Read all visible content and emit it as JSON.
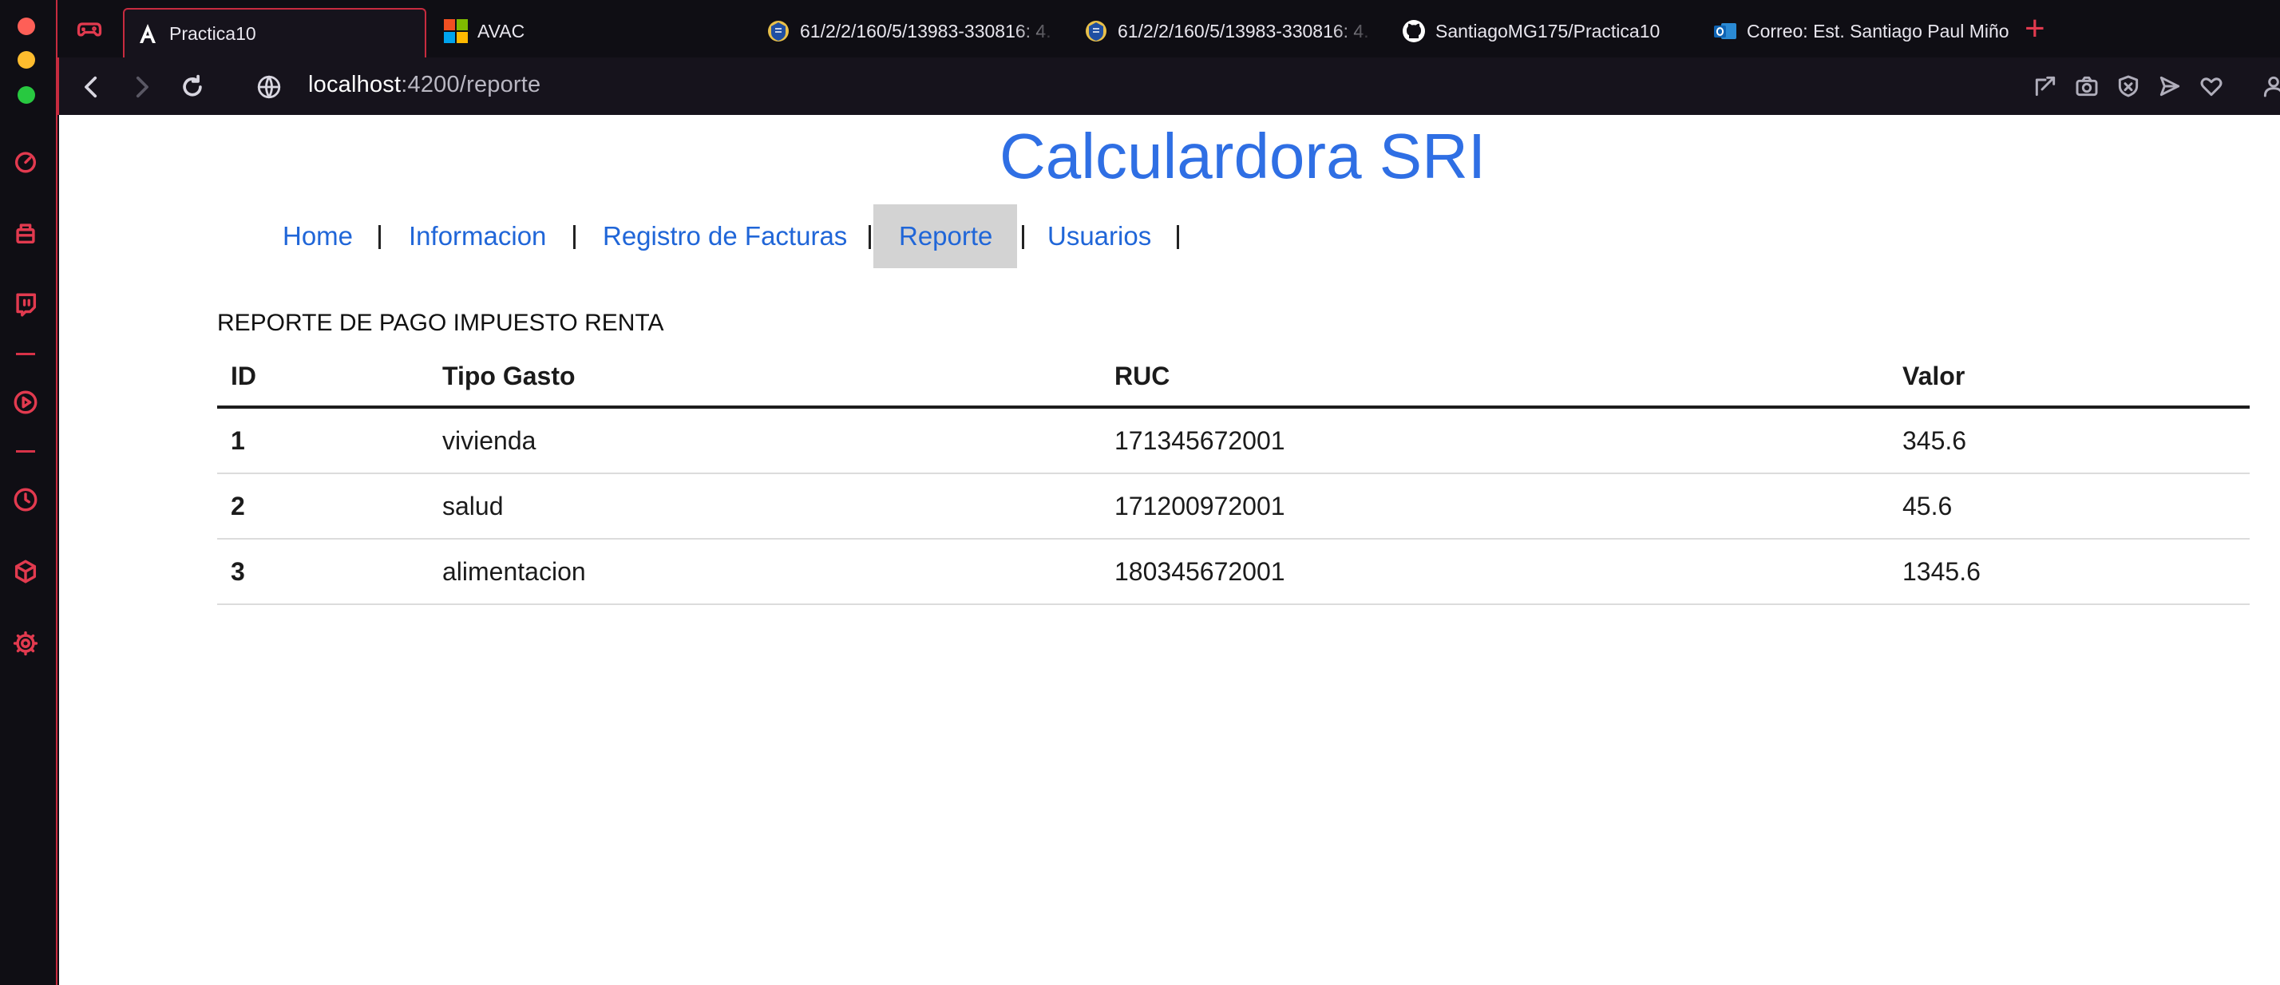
{
  "browser": {
    "tabs": [
      {
        "label": "Practica10",
        "icon": "angular-a-icon",
        "active": true
      },
      {
        "label": "AVAC",
        "icon": "microsoft-logo-icon",
        "active": false
      },
      {
        "label": "61/2/2/160/5/13983-330816: 4.",
        "icon": "university-crest-icon",
        "active": false
      },
      {
        "label": "61/2/2/160/5/13983-330816: 4.",
        "icon": "university-crest-icon",
        "active": false
      },
      {
        "label": "SantiagoMG175/Practica10",
        "icon": "github-icon",
        "active": false
      },
      {
        "label": "Correo: Est. Santiago Paul Miño",
        "icon": "outlook-icon",
        "active": false
      }
    ],
    "new_tab": "+",
    "address": {
      "host": "localhost",
      "path": ":4200/reporte"
    },
    "accent": "#c72b3f"
  },
  "page": {
    "title": "Calculardora SRI",
    "title_color": "#2f6fe4",
    "nav": [
      {
        "label": "Home",
        "active": false
      },
      {
        "label": "Informacion",
        "active": false
      },
      {
        "label": "Registro de Facturas",
        "active": false
      },
      {
        "label": "Reporte",
        "active": true
      },
      {
        "label": "Usuarios",
        "active": false
      }
    ],
    "nav_separator": "|",
    "report_heading": "REPORTE DE PAGO IMPUESTO RENTA",
    "table": {
      "columns": [
        "ID",
        "Tipo Gasto",
        "RUC",
        "Valor"
      ],
      "rows": [
        {
          "id": "1",
          "tipo": "vivienda",
          "ruc": "171345672001",
          "valor": "345.6"
        },
        {
          "id": "2",
          "tipo": "salud",
          "ruc": "171200972001",
          "valor": "45.6"
        },
        {
          "id": "3",
          "tipo": "alimentacion",
          "ruc": "180345672001",
          "valor": "1345.6"
        }
      ]
    }
  }
}
